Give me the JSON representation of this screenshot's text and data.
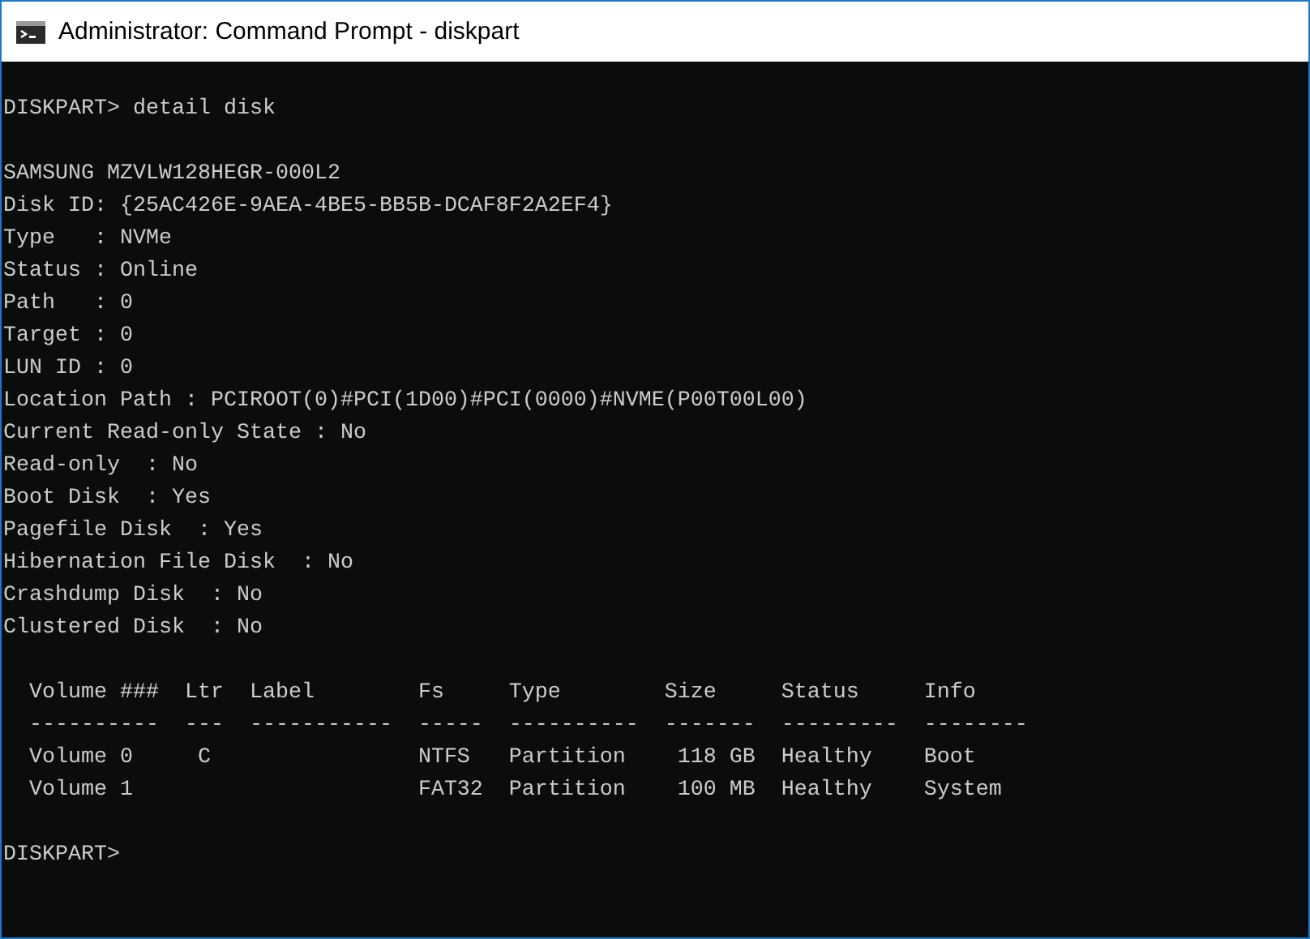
{
  "window": {
    "title": "Administrator: Command Prompt - diskpart"
  },
  "console": {
    "blocks": [
      {
        "lines": [
          "DISKPART> detail disk"
        ]
      },
      {
        "lines": [
          "SAMSUNG MZVLW128HEGR-000L2",
          "Disk ID: {25AC426E-9AEA-4BE5-BB5B-DCAF8F2A2EF4}",
          "Type   : NVMe",
          "Status : Online",
          "Path   : 0",
          "Target : 0",
          "LUN ID : 0",
          "Location Path : PCIROOT(0)#PCI(1D00)#PCI(0000)#NVME(P00T00L00)",
          "Current Read-only State : No",
          "Read-only  : No",
          "Boot Disk  : Yes",
          "Pagefile Disk  : Yes",
          "Hibernation File Disk  : No",
          "Crashdump Disk  : No",
          "Clustered Disk  : No"
        ]
      },
      {
        "lines": [
          "  Volume ###  Ltr  Label        Fs     Type        Size     Status     Info",
          "  ----------  ---  -----------  -----  ----------  -------  ---------  --------",
          "  Volume 0     C                NTFS   Partition    118 GB  Healthy    Boot",
          "  Volume 1                      FAT32  Partition    100 MB  Healthy    System"
        ]
      },
      {
        "lines": [
          "DISKPART>"
        ]
      }
    ]
  }
}
